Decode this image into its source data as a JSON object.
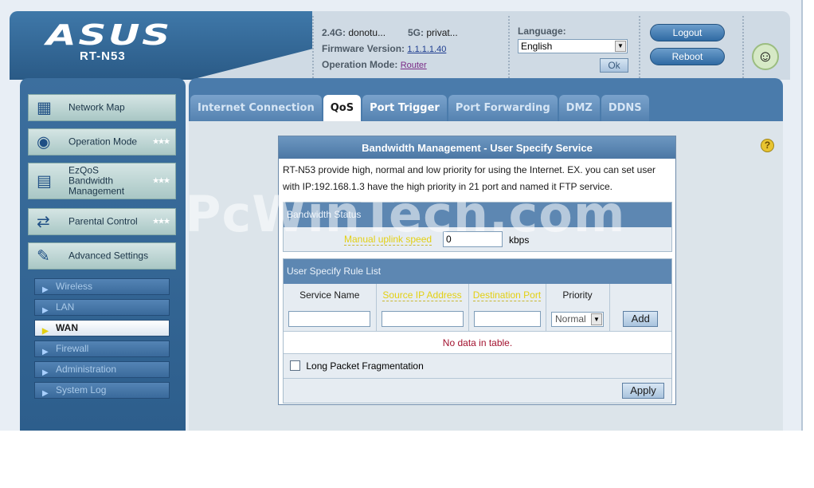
{
  "header": {
    "logo": "ASUS",
    "model": "RT-N53",
    "band24_label": "2.4G:",
    "band24_value": "donotu...",
    "band5_label": "5G:",
    "band5_value": "privat...",
    "firmware_label": "Firmware Version:",
    "firmware_value": "1.1.1.1.40",
    "opmode_label": "Operation Mode:",
    "opmode_value": "Router",
    "language_label": "Language:",
    "language_value": "English",
    "ok_label": "Ok",
    "logout_label": "Logout",
    "reboot_label": "Reboot"
  },
  "sidebar": {
    "items": [
      {
        "label": "Network Map",
        "icon": "network-map-icon"
      },
      {
        "label": "Operation Mode",
        "icon": "router-icon"
      },
      {
        "label": "EzQoS Bandwidth Management",
        "icon": "bandwidth-icon"
      },
      {
        "label": "Parental Control",
        "icon": "parental-control-icon"
      },
      {
        "label": "Advanced Settings",
        "icon": "wrench-icon"
      }
    ],
    "sub_items": [
      {
        "label": "Wireless"
      },
      {
        "label": "LAN"
      },
      {
        "label": "WAN",
        "active": true
      },
      {
        "label": "Firewall"
      },
      {
        "label": "Administration"
      },
      {
        "label": "System Log"
      }
    ]
  },
  "tabs": [
    {
      "label": "Internet Connection"
    },
    {
      "label": "QoS",
      "active": true
    },
    {
      "label": "Port Trigger"
    },
    {
      "label": "Port Forwarding"
    },
    {
      "label": "DMZ"
    },
    {
      "label": "DDNS"
    }
  ],
  "form": {
    "title": "Bandwidth Management - User Specify Service",
    "description": "RT-N53 provide high, normal and low priority for using the Internet. EX. you can set user with IP:192.168.1.3 have the high priority in 21 port and named it FTP service.",
    "bandwidth_status": {
      "heading": "Bandwidth Status",
      "uplink_label": "Manual uplink speed",
      "uplink_value": "0",
      "uplink_unit": "kbps"
    },
    "rule_list": {
      "heading": "User Specify Rule List",
      "columns": [
        "Service Name",
        "Source IP Address",
        "Destination Port",
        "Priority"
      ],
      "priority_value": "Normal",
      "add_label": "Add",
      "empty_text": "No data in table."
    },
    "fragmentation_label": "Long Packet Fragmentation",
    "fragmentation_checked": false,
    "apply_label": "Apply"
  },
  "watermark": "PcWinTech.com",
  "colors": {
    "highlight_label": "#e3d012",
    "empty_text": "#a3122f",
    "panel_blue": "#4a7bab"
  }
}
